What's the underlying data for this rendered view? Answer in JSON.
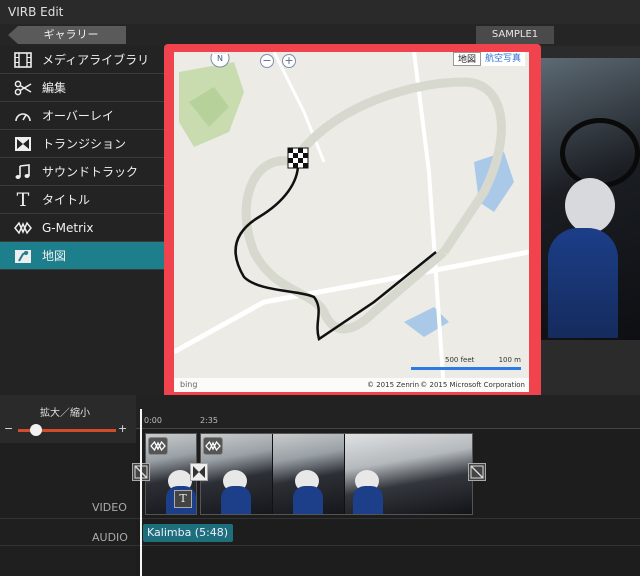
{
  "app": {
    "title": "VIRB Edit"
  },
  "top": {
    "gallery_label": "ギャラリー",
    "project_name": "SAMPLE1"
  },
  "sidebar": {
    "items": [
      {
        "label": "メディアライブラリ",
        "icon": "film-icon"
      },
      {
        "label": "編集",
        "icon": "scissors-icon"
      },
      {
        "label": "オーバーレイ",
        "icon": "gauge-icon"
      },
      {
        "label": "トランジション",
        "icon": "transition-icon"
      },
      {
        "label": "サウンドトラック",
        "icon": "music-note-icon"
      },
      {
        "label": "タイトル",
        "icon": "title-t-icon"
      },
      {
        "label": "G-Metrix",
        "icon": "gmetrix-icon"
      },
      {
        "label": "地図",
        "icon": "map-icon",
        "active": true
      }
    ]
  },
  "map": {
    "nav_label": "N",
    "zoom_out": "−",
    "zoom_in": "+",
    "type_map": "地図",
    "type_aerial": "航空写真",
    "scale_feet": "500 feet",
    "scale_m": "100 m",
    "copyright_zenrin": "© 2015 Zenrin",
    "copyright_ms": "© 2015 Microsoft Corporation",
    "provider": "bing"
  },
  "zoom": {
    "label": "拡大／縮小",
    "minus": "−",
    "plus": "+"
  },
  "timeline": {
    "ticks": [
      "0:00",
      "2:35"
    ],
    "video_label": "VIDEO",
    "audio_label": "AUDIO",
    "audio_clip": "Kalimba  (5:48)",
    "title_btn": "T"
  },
  "colors": {
    "accent": "#1e7f8c",
    "modal_border": "#f0434e",
    "zoom_track": "#d34b2b"
  }
}
